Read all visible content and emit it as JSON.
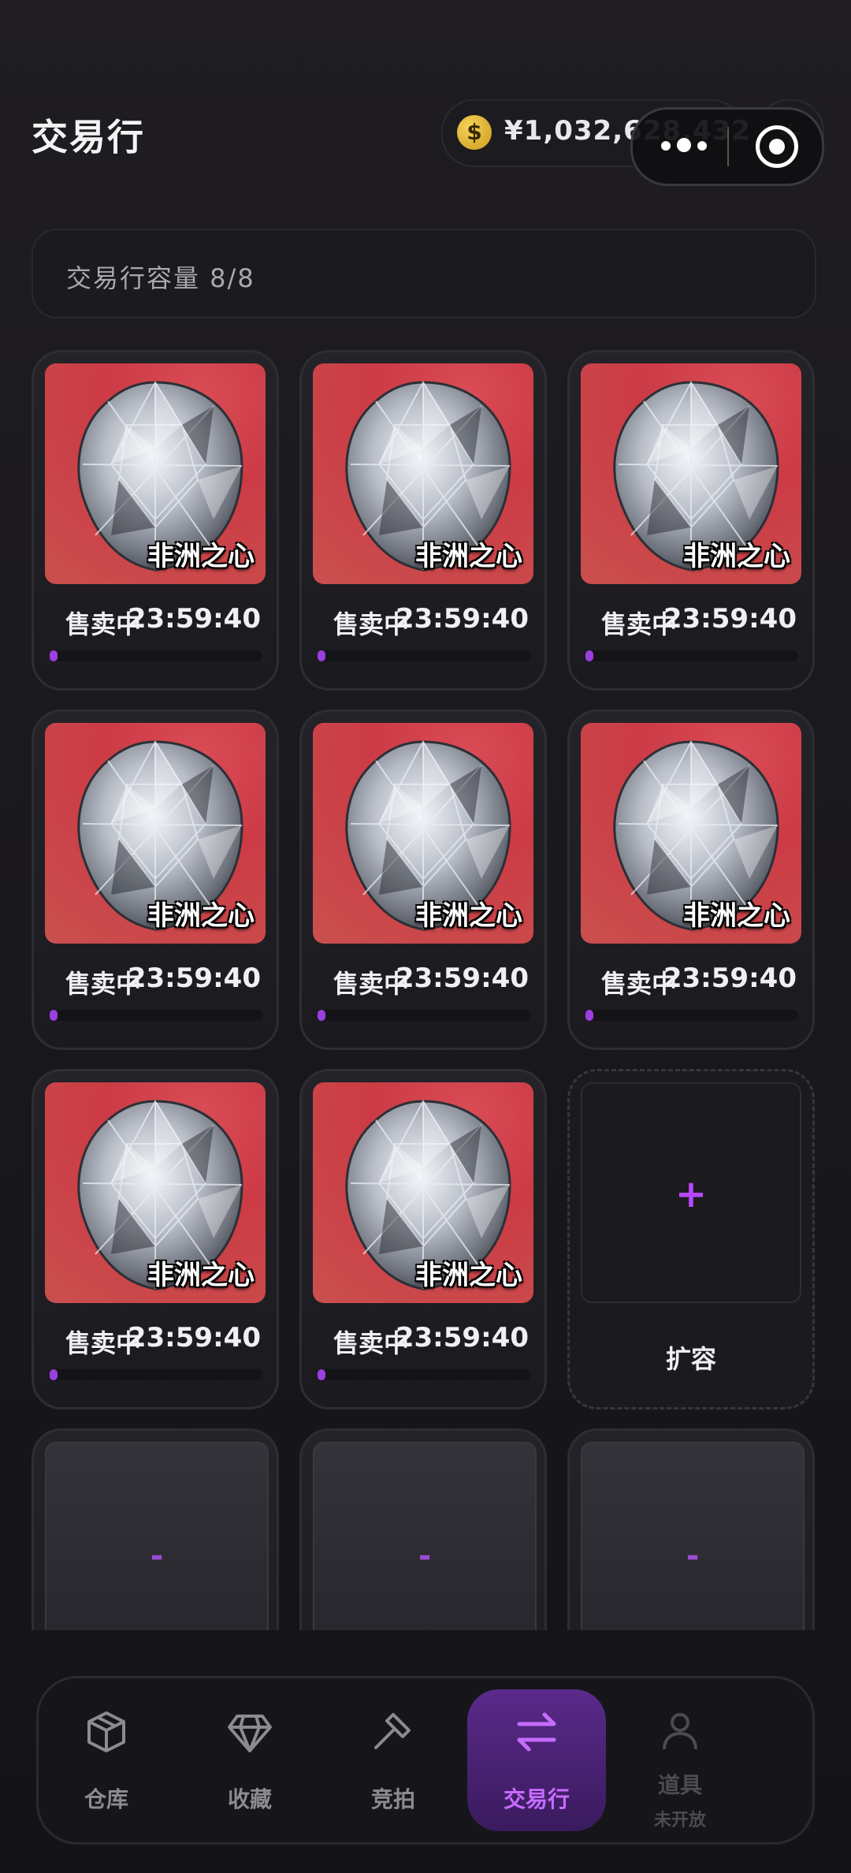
{
  "header": {
    "title": "交易行",
    "balance": "¥1,032,628,432",
    "coin_symbol": "$",
    "add_symbol": "+"
  },
  "capacity": {
    "label": "交易行容量 8/8"
  },
  "listings": [
    {
      "name": "非洲之心",
      "status": "售卖中",
      "timer": "23:59:40",
      "progress": 0.02
    },
    {
      "name": "非洲之心",
      "status": "售卖中",
      "timer": "23:59:40",
      "progress": 0.02
    },
    {
      "name": "非洲之心",
      "status": "售卖中",
      "timer": "23:59:40",
      "progress": 0.02
    },
    {
      "name": "非洲之心",
      "status": "售卖中",
      "timer": "23:59:40",
      "progress": 0.02
    },
    {
      "name": "非洲之心",
      "status": "售卖中",
      "timer": "23:59:40",
      "progress": 0.02
    },
    {
      "name": "非洲之心",
      "status": "售卖中",
      "timer": "23:59:40",
      "progress": 0.02
    },
    {
      "name": "非洲之心",
      "status": "售卖中",
      "timer": "23:59:40",
      "progress": 0.02
    },
    {
      "name": "非洲之心",
      "status": "售卖中",
      "timer": "23:59:40",
      "progress": 0.02
    }
  ],
  "expand_slot": {
    "plus": "+",
    "label": "扩容"
  },
  "locked_slots": [
    {
      "mark": "-"
    },
    {
      "mark": "-"
    },
    {
      "mark": "-"
    }
  ],
  "nav": {
    "items": [
      {
        "label": "仓库",
        "icon": "box-icon",
        "active": false
      },
      {
        "label": "收藏",
        "icon": "diamond-icon",
        "active": false
      },
      {
        "label": "竞拍",
        "icon": "hammer-icon",
        "active": false
      },
      {
        "label": "交易行",
        "icon": "swap-arrows-icon",
        "active": true
      },
      {
        "label": "道具",
        "sub": "未开放",
        "icon": "person-icon",
        "active": false,
        "disabled": true
      }
    ]
  },
  "colors": {
    "accent": "#b548ff",
    "card_bg": "#cc3b45",
    "progress": "#9b3fe0"
  }
}
